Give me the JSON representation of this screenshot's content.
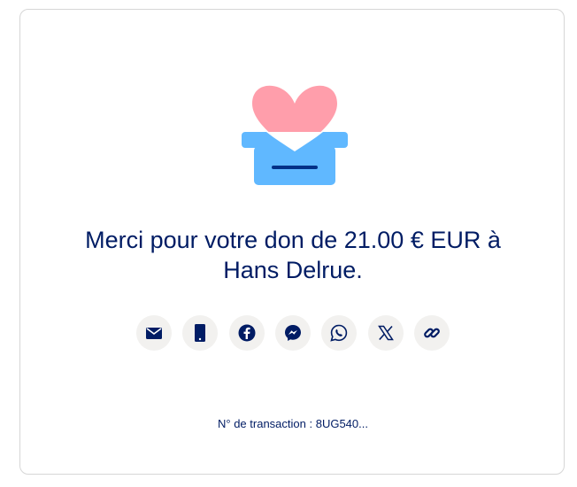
{
  "confirmation": {
    "title_line1": "Merci pour votre don de 21.00 € EUR à",
    "title_line2": "Hans Delrue."
  },
  "share": {
    "buttons": [
      {
        "icon": "email-icon",
        "label": "Email"
      },
      {
        "icon": "phone-icon",
        "label": "SMS"
      },
      {
        "icon": "facebook-icon",
        "label": "Facebook"
      },
      {
        "icon": "messenger-icon",
        "label": "Messenger"
      },
      {
        "icon": "whatsapp-icon",
        "label": "WhatsApp"
      },
      {
        "icon": "x-icon",
        "label": "X"
      },
      {
        "icon": "link-icon",
        "label": "Copy link"
      }
    ]
  },
  "transaction": {
    "label": "N° de transaction :",
    "id_visible": "8UG540..."
  },
  "colors": {
    "text": "#001c64",
    "heart": "#ff9eab",
    "box": "#60b8ff",
    "slot": "#003087",
    "icon_bg": "#f2f1ef"
  }
}
